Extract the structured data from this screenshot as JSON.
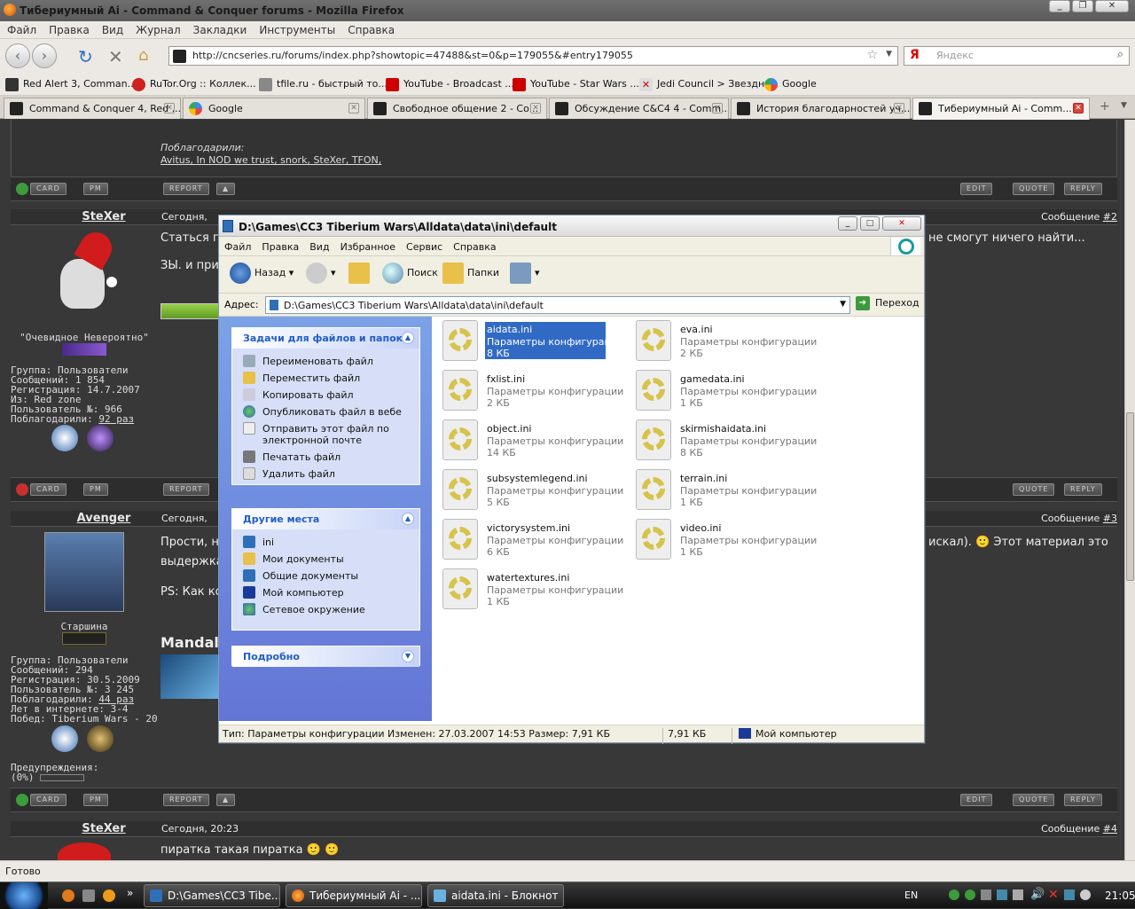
{
  "window_title": "Тибериумный Ai - Command & Conquer forums - Mozilla Firefox",
  "menu": [
    "Файл",
    "Правка",
    "Вид",
    "Журнал",
    "Закладки",
    "Инструменты",
    "Справка"
  ],
  "url": "http://cncseries.ru/forums/index.php?showtopic=47488&st=0&p=179055&#entry179055",
  "search_placeholder": "Яндекс",
  "bookmarks": [
    "Red Alert 3, Comman...",
    "RuTor.Org :: Коллек...",
    "tfile.ru - быстрый то...",
    "YouTube - Broadcast ...",
    "YouTube - Star Wars ...",
    "Jedi Council > Звездн...",
    "Google"
  ],
  "tabs": [
    "Command & Conquer 4, Red ...",
    "Google",
    "Свободное общение 2 - Co...",
    "Обсуждение C&C4 4 - Comm...",
    "История благодарностей уч...",
    "Тибериумный Ai - Comm..."
  ],
  "forum": {
    "thanked_label": "Поблагодарили:",
    "thanked_users": "Avitus, In NOD we trust, snork, SteXer, TFON,",
    "btn_card": "CARD",
    "btn_pm": "PM",
    "btn_report": "REPORT",
    "btn_edit": "EDIT",
    "btn_quote": "QUOTE",
    "btn_reply": "REPLY",
    "post2": {
      "user": "SteXer",
      "date": "Сегодня,",
      "num_label": "Сообщение",
      "num": "#2",
      "text1": "Статься п",
      "text1_right": "не смогут ничего найти...",
      "text2": "ЗЫ. и при",
      "title": "\"Очевидное Невероятно\"",
      "info": [
        "Группа: Пользователи",
        "Сообщений: 1 854",
        "Регистрация: 14.7.2007",
        "Из: Red zone",
        "Пользователь №: 966"
      ],
      "thanks_label": "Поблагодарили:",
      "thanks_val": "92 раз"
    },
    "post3": {
      "user": "Avenger",
      "date": "Сегодня,",
      "num_label": "Сообщение",
      "num": "#3",
      "text1": "Прости, н",
      "text1_right": "искал). 🙂 Этот материал это",
      "text2": "выдержка",
      "text3": "PS: Как ко",
      "sig": "Mandal",
      "rank": "Старшина",
      "info": [
        "Группа: Пользователи",
        "Сообщений: 294",
        "Регистрация: 30.5.2009",
        "Пользователь №: 3 245"
      ],
      "thanks_label": "Поблагодарили:",
      "thanks_val": "44 раз",
      "info2": [
        "Лет в интернете: 3-4",
        "Побед: Tiberium Wars - 20"
      ],
      "warn_label": "Предупреждения:",
      "warn_val": "(0%)"
    },
    "post4": {
      "user": "SteXer",
      "date": "Сегодня, 20:23",
      "num_label": "Сообщение",
      "num": "#4",
      "text": "пиратка такая пиратка 🙂 🙂"
    }
  },
  "explorer": {
    "title": "D:\\Games\\CC3 Tiberium Wars\\Alldata\\data\\ini\\default",
    "menu": [
      "Файл",
      "Правка",
      "Вид",
      "Избранное",
      "Сервис",
      "Справка"
    ],
    "back": "Назад",
    "search": "Поиск",
    "folders": "Папки",
    "addr_label": "Адрес:",
    "addr_value": "D:\\Games\\CC3 Tiberium Wars\\Alldata\\data\\ini\\default",
    "go": "Переход",
    "tasks_title": "Задачи для файлов и папок",
    "tasks": [
      "Переименовать файл",
      "Переместить файл",
      "Копировать файл",
      "Опубликовать файл в вебе",
      "Отправить этот файл по электронной почте",
      "Печатать файл",
      "Удалить файл"
    ],
    "places_title": "Другие места",
    "places": [
      "ini",
      "Мои документы",
      "Общие документы",
      "Мой компьютер",
      "Сетевое окружение"
    ],
    "details_title": "Подробно",
    "files": [
      {
        "name": "aidata.ini",
        "type": "Параметры конфигурации",
        "size": "8 КБ"
      },
      {
        "name": "eva.ini",
        "type": "Параметры конфигурации",
        "size": "2 КБ"
      },
      {
        "name": "fxlist.ini",
        "type": "Параметры конфигурации",
        "size": "2 КБ"
      },
      {
        "name": "gamedata.ini",
        "type": "Параметры конфигурации",
        "size": "1 КБ"
      },
      {
        "name": "object.ini",
        "type": "Параметры конфигурации",
        "size": "14 КБ"
      },
      {
        "name": "skirmishaidata.ini",
        "type": "Параметры конфигурации",
        "size": "8 КБ"
      },
      {
        "name": "subsystemlegend.ini",
        "type": "Параметры конфигурации",
        "size": "5 КБ"
      },
      {
        "name": "terrain.ini",
        "type": "Параметры конфигурации",
        "size": "1 КБ"
      },
      {
        "name": "victorysystem.ini",
        "type": "Параметры конфигурации",
        "size": "6 КБ"
      },
      {
        "name": "video.ini",
        "type": "Параметры конфигурации",
        "size": "1 КБ"
      },
      {
        "name": "watertextures.ini",
        "type": "Параметры конфигурации",
        "size": "1 КБ"
      }
    ],
    "status_info": "Тип: Параметры конфигурации Изменен: 27.03.2007 14:53 Размер: 7,91 КБ",
    "status_size": "7,91 КБ",
    "status_loc": "Мой компьютер"
  },
  "ff_status": "Готово",
  "taskbar": {
    "tasks": [
      "D:\\Games\\CC3 Tibe...",
      "Тибериумный Ai - ...",
      "aidata.ini - Блокнот"
    ],
    "lang": "EN",
    "clock": "21:05"
  }
}
